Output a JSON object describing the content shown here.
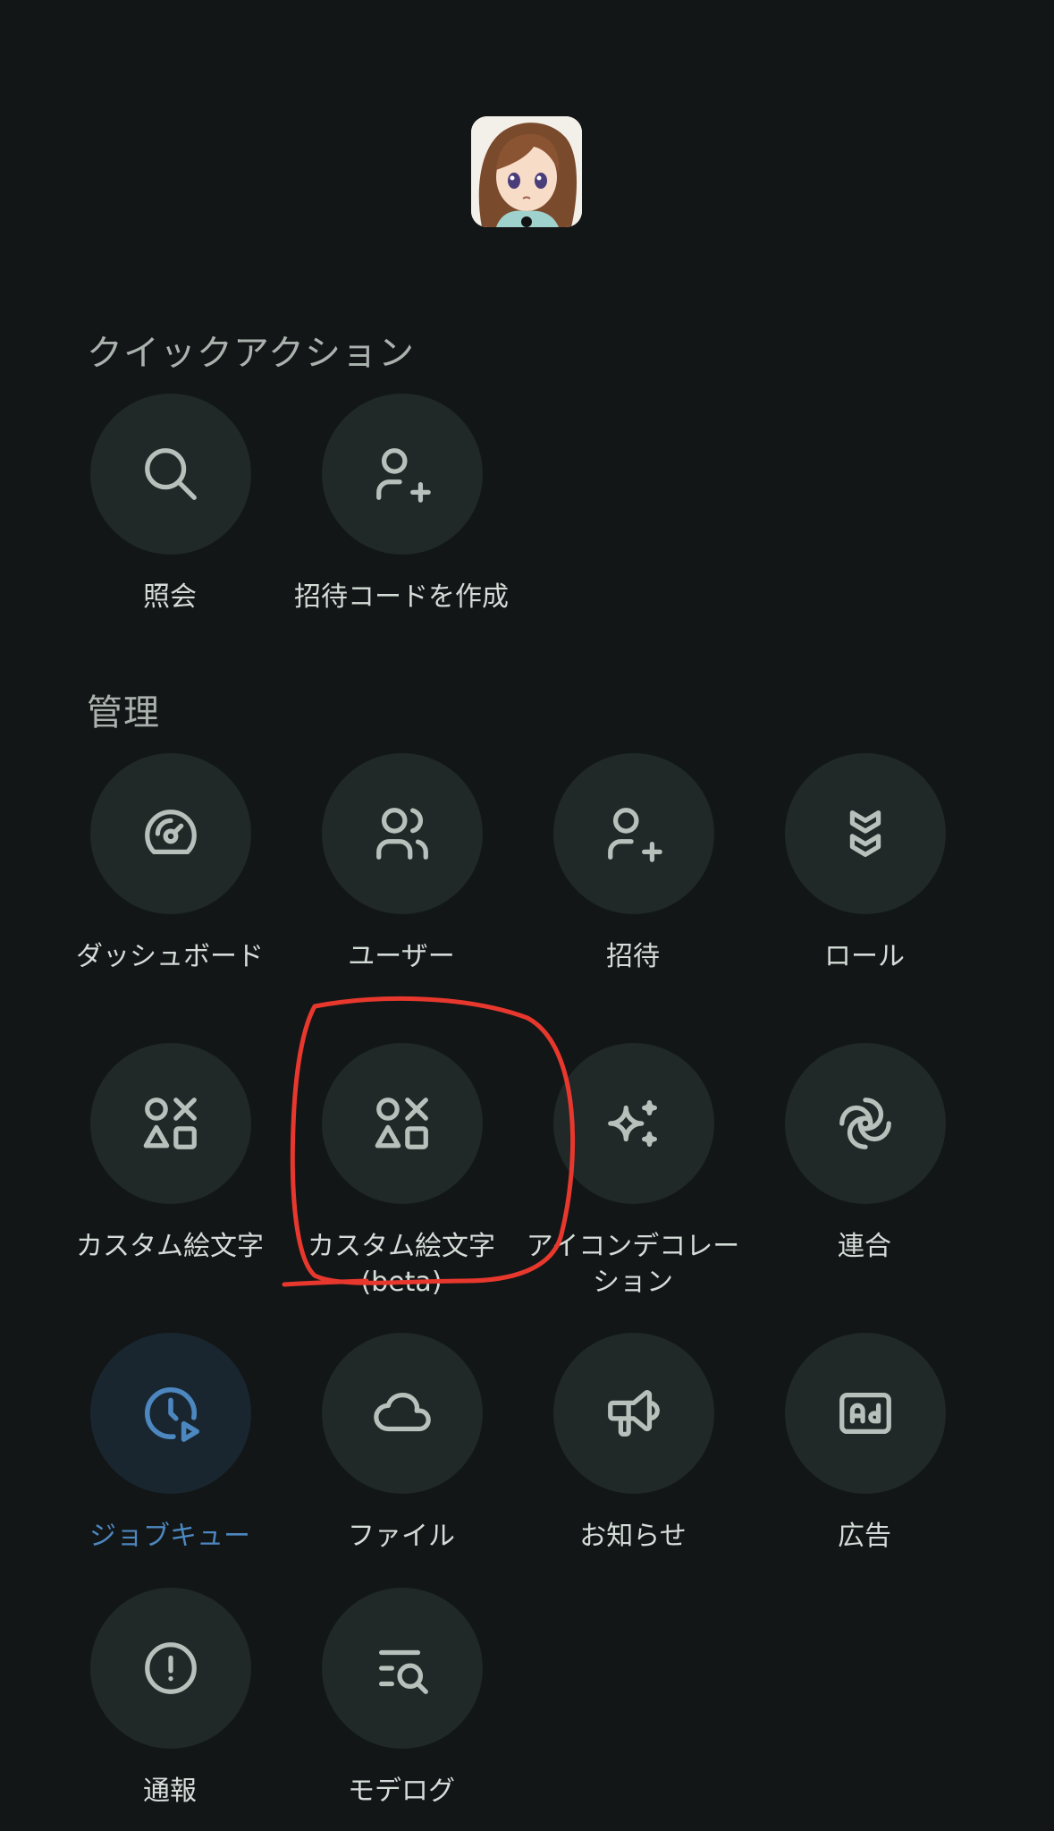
{
  "quick_actions": {
    "title": "クイックアクション",
    "items": [
      {
        "label": "照会",
        "icon": "search-icon"
      },
      {
        "label": "招待コードを作成",
        "icon": "user-plus-icon"
      }
    ]
  },
  "management": {
    "title": "管理",
    "items": [
      {
        "label": "ダッシュボード",
        "icon": "gauge-icon"
      },
      {
        "label": "ユーザー",
        "icon": "users-icon"
      },
      {
        "label": "招待",
        "icon": "user-plus-icon"
      },
      {
        "label": "ロール",
        "icon": "badges-icon"
      },
      {
        "label": "カスタム絵文字",
        "icon": "shapes-icon"
      },
      {
        "label": "カスタム絵文字(beta)",
        "icon": "shapes-icon"
      },
      {
        "label": "アイコンデコレーション",
        "icon": "sparkles-icon"
      },
      {
        "label": "連合",
        "icon": "whirl-icon"
      },
      {
        "label": "ジョブキュー",
        "icon": "clock-play-icon",
        "active": true
      },
      {
        "label": "ファイル",
        "icon": "cloud-icon"
      },
      {
        "label": "お知らせ",
        "icon": "speakerphone-icon"
      },
      {
        "label": "広告",
        "icon": "ad-icon"
      },
      {
        "label": "通報",
        "icon": "exclamation-circle-icon"
      },
      {
        "label": "モデログ",
        "icon": "list-search-icon"
      }
    ]
  },
  "colors": {
    "background": "#121616",
    "button": "#202828",
    "active_button": "#192630",
    "active_text": "#4d87c0",
    "text": "#d4dcd8",
    "icon": "#b8c0bc",
    "annotation": "#e8382e"
  }
}
